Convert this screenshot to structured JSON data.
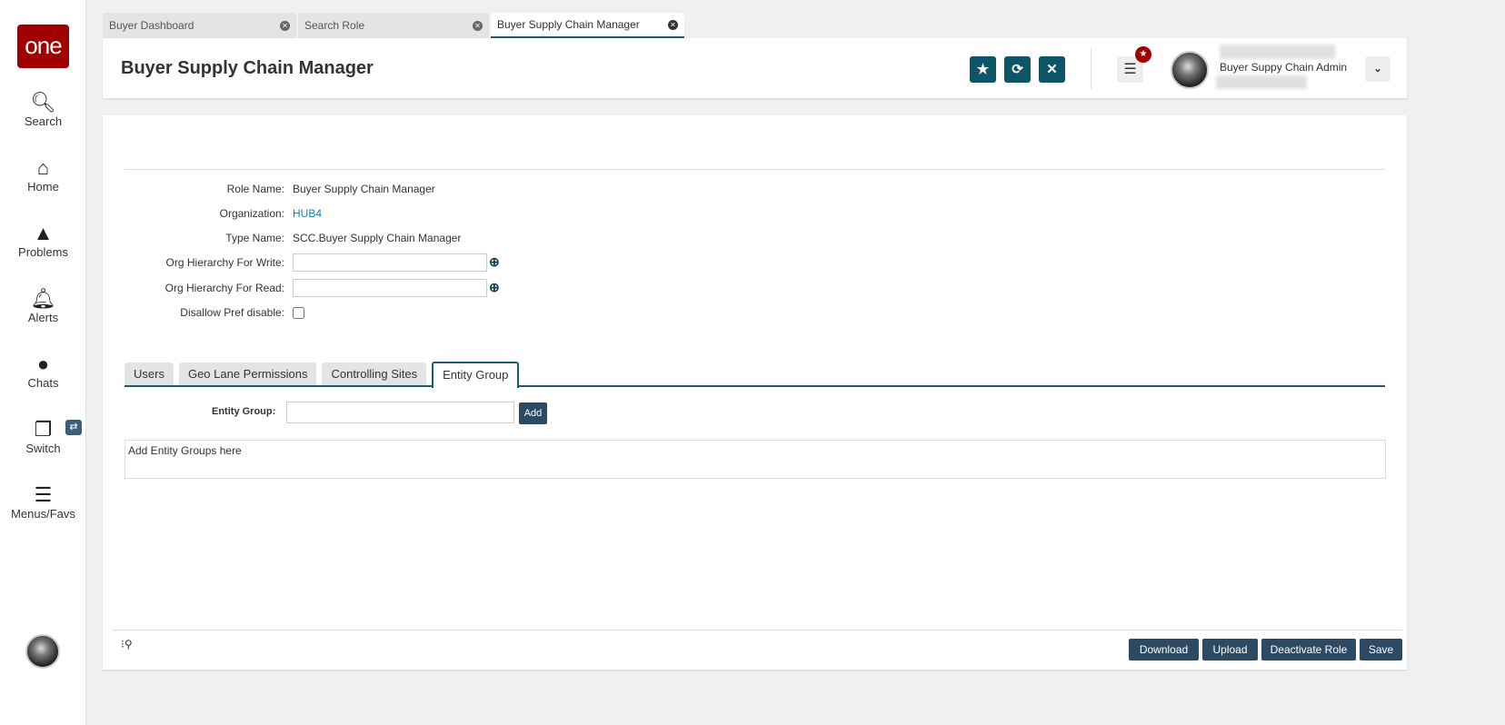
{
  "sidebar": {
    "logo": "one",
    "items": [
      {
        "label": "Search",
        "icon": "search-icon",
        "glyph": "🔍"
      },
      {
        "label": "Home",
        "icon": "home-icon",
        "glyph": "⌂"
      },
      {
        "label": "Problems",
        "icon": "warning-icon",
        "glyph": "▲"
      },
      {
        "label": "Alerts",
        "icon": "bell-icon",
        "glyph": "🔔"
      },
      {
        "label": "Chats",
        "icon": "chat-icon",
        "glyph": "●"
      },
      {
        "label": "Switch",
        "icon": "switch-icon",
        "glyph": "❐"
      },
      {
        "label": "Menus/Favs",
        "icon": "menu-icon",
        "glyph": "☰"
      }
    ],
    "switch_badge": "⇄"
  },
  "tabs": [
    {
      "label": "Buyer Dashboard"
    },
    {
      "label": "Search Role"
    },
    {
      "label": "Buyer Supply Chain Manager",
      "active": true
    }
  ],
  "header": {
    "title": "Buyer Supply Chain Manager",
    "user": "Buyer Suppy Chain Admin",
    "notification_icon": "★"
  },
  "form": {
    "role_name_label": "Role Name:",
    "role_name": "Buyer Supply Chain Manager",
    "organization_label": "Organization:",
    "organization": "HUB4",
    "type_name_label": "Type Name:",
    "type_name": "SCC.Buyer Supply Chain Manager",
    "write_label": "Org Hierarchy For Write:",
    "write_value": "",
    "read_label": "Org Hierarchy For Read:",
    "read_value": "",
    "disallow_label": "Disallow Pref disable:",
    "disallow_checked": false
  },
  "subtabs": [
    {
      "label": "Users"
    },
    {
      "label": "Geo Lane Permissions"
    },
    {
      "label": "Controlling Sites"
    },
    {
      "label": "Entity Group",
      "active": true
    }
  ],
  "entity_group": {
    "label": "Entity Group:",
    "value": "",
    "add": "Add",
    "placeholder_text": "Add Entity Groups here"
  },
  "footer": {
    "download": "Download",
    "upload": "Upload",
    "deactivate": "Deactivate Role",
    "save": "Save"
  },
  "colors": {
    "brand": "#a00000",
    "accent": "#0d5669",
    "button": "#2c4a62",
    "link": "#1a7fa8"
  }
}
